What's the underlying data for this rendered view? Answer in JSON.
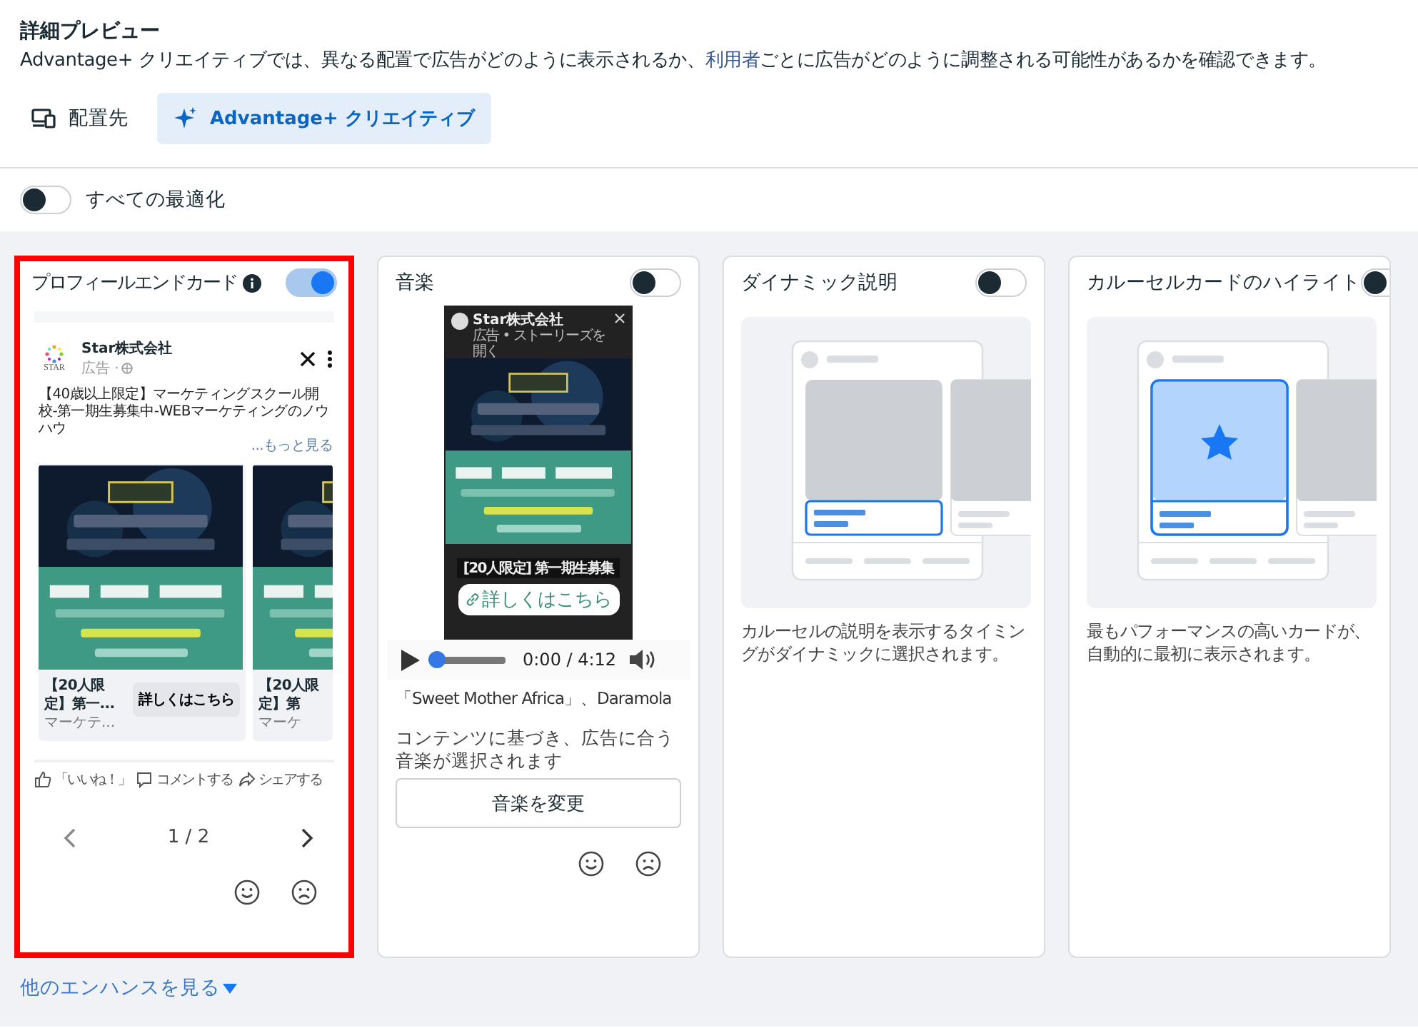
{
  "header": {
    "title": "詳細プレビュー",
    "description_before": "Advantage+ クリエイティブでは、異なる配置で広告がどのように表示されるか、",
    "description_link": "利用者",
    "description_after": "ごとに広告がどのように調整される可能性があるかを確認できます。"
  },
  "tabs": [
    {
      "kind": "devices",
      "label": "配置先",
      "selected": false
    },
    {
      "kind": "sparkle",
      "label": "Advantage+ クリエイティブ",
      "selected": true
    }
  ],
  "optimize_all": {
    "label": "すべての最適化",
    "on": false
  },
  "cards": [
    {
      "kind": "post",
      "title": "プロフィールエンドカード",
      "info_icon": true,
      "on": true,
      "highlighted": true,
      "post": {
        "logo_text": "STAR",
        "advertiser": "Star株式会社",
        "sponsored": "広告 ·",
        "text": "【40歳以上限定】マーケティングスクール開校-第一期生募集中-WEBマーケティングのノウハウ",
        "more": "...もっと見る",
        "carousel": [
          {
            "title": "【20人限定】第一...",
            "subtitle": "マーケテ...",
            "cta": "詳しくはこちら"
          },
          {
            "title": "【20人限定】第",
            "subtitle": "マーケ"
          }
        ],
        "actions": [
          {
            "kind": "like",
            "label": "「いいね！」"
          },
          {
            "kind": "comment",
            "label": "コメントする"
          },
          {
            "kind": "share",
            "label": "シェアする"
          }
        ]
      },
      "pager": "1 / 2"
    },
    {
      "kind": "music",
      "title": "音楽",
      "on": false,
      "highlighted": false,
      "story": {
        "advertiser": "Star株式会社",
        "subtitle": "広告 • ストーリーズを開く",
        "caption": "[20人限定] 第一期生募集",
        "cta": "詳しくはこちら"
      },
      "player": {
        "time": "0:00 / 4:12",
        "level": 0
      },
      "track": "「Sweet Mother Africa」、Daramola",
      "description": "コンテンツに基づき、広告に合う音楽が選択されます",
      "button": "音楽を変更"
    },
    {
      "kind": "caption_illustration",
      "title": "ダイナミック説明",
      "on": false,
      "highlighted": false,
      "description": "カルーセルの説明を表示するタイミングがダイナミックに選択されます。"
    },
    {
      "kind": "star_illustration",
      "title": "カルーセルカードのハイライト",
      "on": false,
      "highlighted": false,
      "description": "最もパフォーマンスの高いカードが、自動的に最初に表示されます。"
    }
  ],
  "footer": {
    "more_link": "他のエンハンスを見る"
  }
}
